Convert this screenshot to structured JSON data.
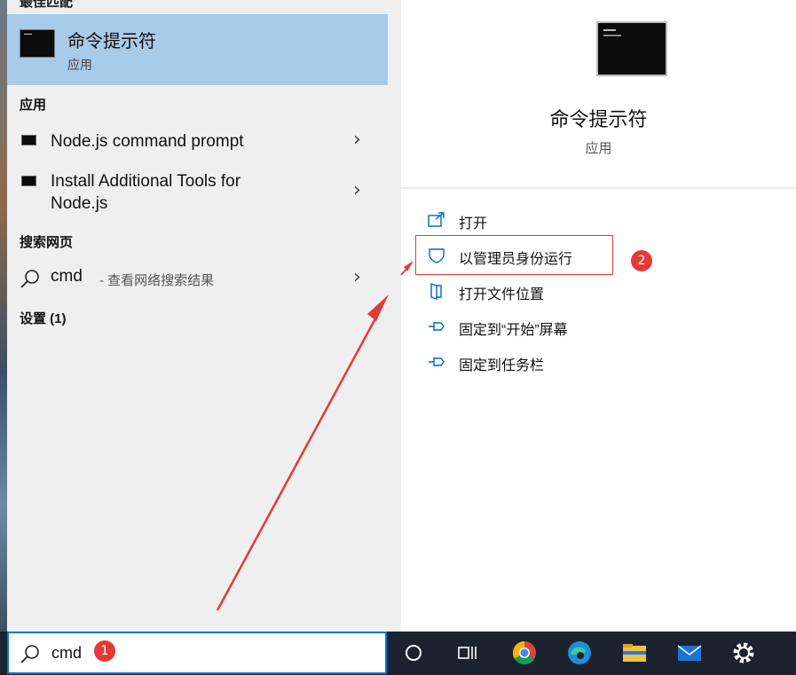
{
  "search_panel": {
    "cut_header": "最佳匹配",
    "best_match": {
      "title": "命令提示符",
      "subtitle": "应用"
    },
    "apps_header": "应用",
    "apps": [
      {
        "label": "Node.js command prompt"
      },
      {
        "label_line1": "Install Additional Tools for",
        "label_line2": "Node.js"
      }
    ],
    "web_header": "搜索网页",
    "web_result": {
      "query": "cmd",
      "suffix": "- 查看网络搜索结果"
    },
    "settings_header": "设置 (1)"
  },
  "detail_panel": {
    "title": "命令提示符",
    "subtitle": "应用",
    "actions": [
      {
        "label": "打开",
        "icon": "open-icon"
      },
      {
        "label": "以管理员身份运行",
        "icon": "shield-icon"
      },
      {
        "label": "打开文件位置",
        "icon": "file-location-icon"
      },
      {
        "label": "固定到“开始”屏幕",
        "icon": "pin-icon"
      },
      {
        "label": "固定到任务栏",
        "icon": "pin-icon"
      }
    ]
  },
  "annotations": {
    "badge_1": "1",
    "badge_2": "2",
    "color": "#e53935"
  },
  "taskbar": {
    "search_value": "cmd",
    "icons": [
      "cortana-icon",
      "task-view-icon",
      "chrome-icon",
      "edge-icon",
      "file-explorer-icon",
      "mail-icon",
      "settings-icon"
    ]
  },
  "colors": {
    "selection": "#a9cbea",
    "accent": "#0078d7",
    "taskbar": "#1b232e"
  }
}
